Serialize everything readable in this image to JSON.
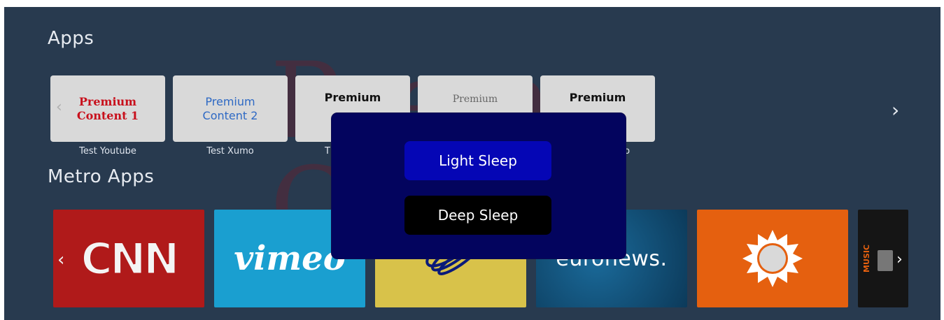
{
  "apps": {
    "title": "Apps",
    "tiles": [
      {
        "line1": "Premium",
        "line2": "Content 1",
        "label": "Test Youtube"
      },
      {
        "line1": "Premium",
        "line2": "Content 2",
        "label": "Test Xumo"
      },
      {
        "line1": "Premium",
        "label": "T"
      },
      {
        "line1": "Premium"
      },
      {
        "line1": "Premium",
        "label": "udio"
      }
    ]
  },
  "metro": {
    "title": "Metro Apps",
    "tiles": [
      {
        "logo": "CNN"
      },
      {
        "logo": "vimeo"
      },
      {
        "logo": ""
      },
      {
        "logo": "euronews."
      },
      {
        "logo": ""
      },
      {
        "logo": "MUSIC"
      }
    ]
  },
  "sleep_dialog": {
    "light_label": "Light Sleep",
    "deep_label": "Deep Sleep"
  },
  "icons": {
    "prev": "chevron-left-icon",
    "next": "chevron-right-icon",
    "sun": "sun-icon",
    "globe": "globe-icon"
  },
  "colors": {
    "background": "#283a4f",
    "dialog": "#03045e",
    "light_button": "#0506b5",
    "deep_button": "#000000"
  }
}
